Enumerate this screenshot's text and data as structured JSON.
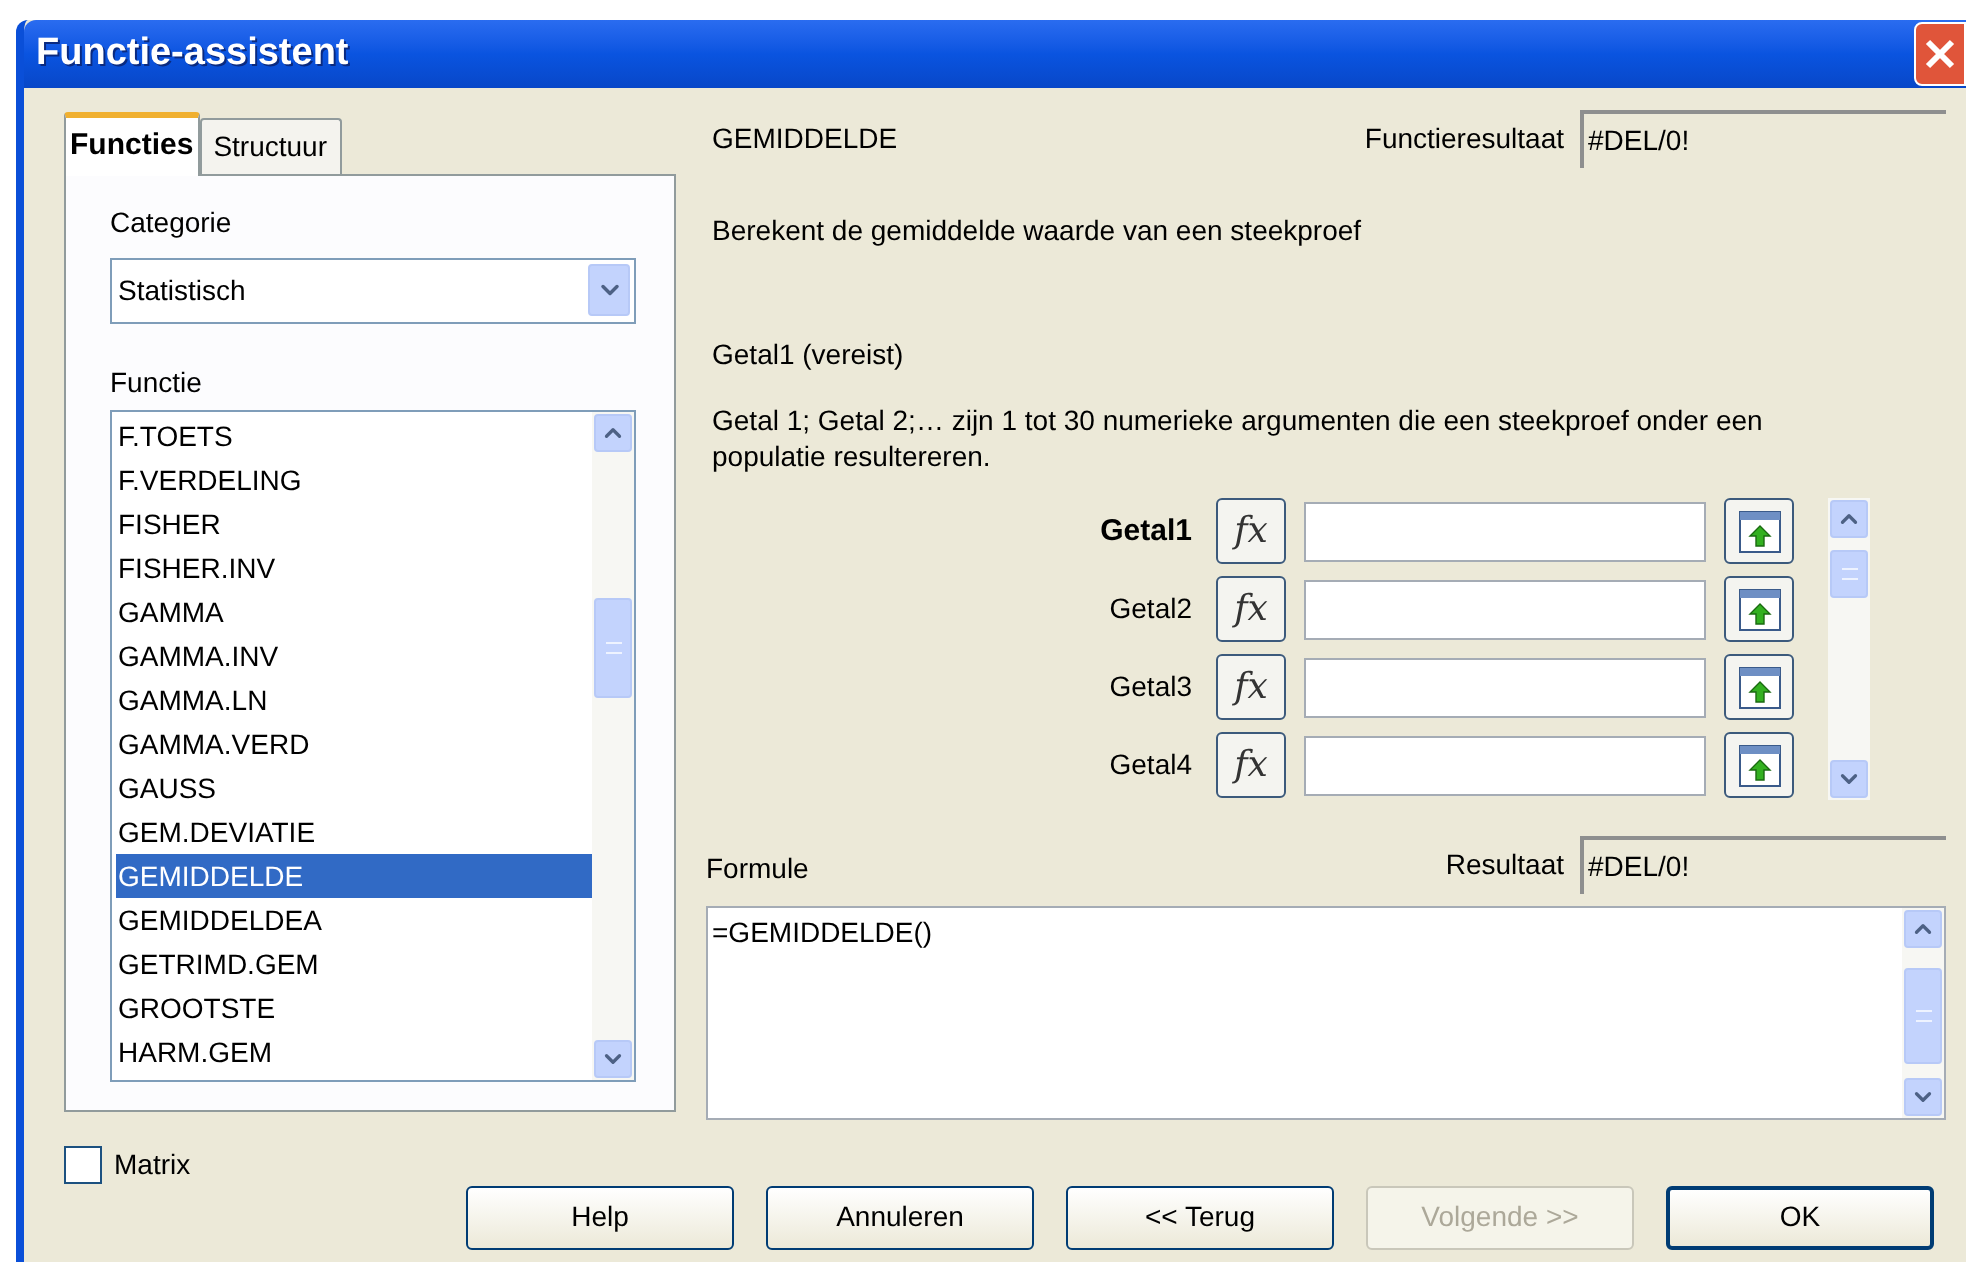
{
  "window": {
    "title": "Functie-assistent"
  },
  "tabs": [
    {
      "label": "Functies",
      "selected": true
    },
    {
      "label": "Structuur",
      "selected": false
    }
  ],
  "category": {
    "label": "Categorie",
    "value": "Statistisch"
  },
  "function_list": {
    "label": "Functie",
    "items": [
      {
        "label": "F.TOETS",
        "selected": false
      },
      {
        "label": "F.VERDELING",
        "selected": false
      },
      {
        "label": "FISHER",
        "selected": false
      },
      {
        "label": "FISHER.INV",
        "selected": false
      },
      {
        "label": "GAMMA",
        "selected": false
      },
      {
        "label": "GAMMA.INV",
        "selected": false
      },
      {
        "label": "GAMMA.LN",
        "selected": false
      },
      {
        "label": "GAMMA.VERD",
        "selected": false
      },
      {
        "label": "GAUSS",
        "selected": false
      },
      {
        "label": "GEM.DEVIATIE",
        "selected": false
      },
      {
        "label": "GEMIDDELDE",
        "selected": true
      },
      {
        "label": "GEMIDDELDEA",
        "selected": false
      },
      {
        "label": "GETRIMD.GEM",
        "selected": false
      },
      {
        "label": "GROOTSTE",
        "selected": false
      },
      {
        "label": "HARM.GEM",
        "selected": false
      }
    ]
  },
  "function_name": "GEMIDDELDE",
  "function_result": {
    "label": "Functieresultaat",
    "value": "#DEL/0!"
  },
  "description": "Berekent de gemiddelde waarde van een steekproef",
  "argument_title": "Getal1 (vereist)",
  "argument_description": "Getal 1; Getal 2;… zijn 1 tot 30 numerieke argumenten die een steekproef onder een populatie resultereren.",
  "arguments": [
    {
      "label": "Getal1",
      "function_button": "fx",
      "active": true
    },
    {
      "label": "Getal2",
      "function_button": "fx",
      "active": false
    },
    {
      "label": "Getal3",
      "function_button": "fx",
      "active": false
    },
    {
      "label": "Getal4",
      "function_button": "fx",
      "active": false
    }
  ],
  "formula": {
    "label": "Formule",
    "value": "=GEMIDDELDE()"
  },
  "result": {
    "label": "Resultaat",
    "value": "#DEL/0!"
  },
  "matrix": {
    "label": "Matrix",
    "checked": false
  },
  "buttons": [
    {
      "label": "Help",
      "disabled": false,
      "default": false
    },
    {
      "label": "Annuleren",
      "disabled": false,
      "default": false
    },
    {
      "label": "<< Terug",
      "disabled": false,
      "default": false
    },
    {
      "label": "Volgende >>",
      "disabled": true,
      "default": false
    },
    {
      "label": "OK",
      "disabled": false,
      "default": true
    }
  ]
}
